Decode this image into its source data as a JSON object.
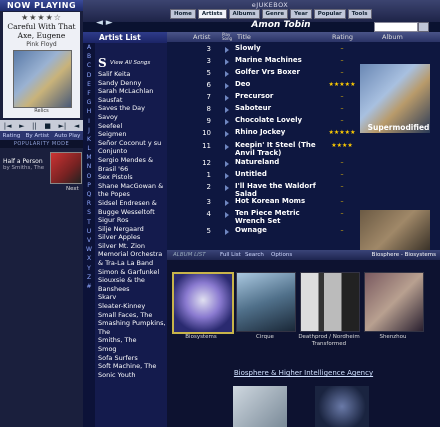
{
  "left": {
    "now_playing": "NOW PLAYING",
    "stars": "★★★★☆",
    "song": "Careful With That Axe, Eugene",
    "artist": "Pink Floyd",
    "album": "Relics",
    "controls": [
      "|◄",
      "►",
      "||",
      "■",
      "►|",
      "◄"
    ],
    "tabs": [
      "Rating",
      "By Artist",
      "Auto Play"
    ],
    "popularity_mode": "POPULARITY MODE",
    "next_song": "Half a Person",
    "next_artist": "by Smiths, The",
    "next_label": "Next"
  },
  "header": {
    "app_title": "eJUKEBOX",
    "nav": [
      "Home",
      "Artists",
      "Albums",
      "Genre",
      "Year",
      "Popular",
      "Tools"
    ],
    "active_nav": "Artists",
    "back": "◄",
    "forward": "►",
    "current_artist": "Amon Tobin"
  },
  "artist_list": {
    "title": "Artist List",
    "alphabet": [
      "A",
      "B",
      "C",
      "D",
      "E",
      "F",
      "G",
      "H",
      "I",
      "J",
      "K",
      "L",
      "M",
      "N",
      "O",
      "P",
      "Q",
      "R",
      "S",
      "T",
      "U",
      "V",
      "W",
      "X",
      "Y",
      "Z",
      "#"
    ],
    "letter": "S",
    "view_all": "View All Songs",
    "artists": [
      "Salif Keita",
      "Sandy Denny",
      "Sarah McLachlan",
      "Sausfat",
      "Saves the Day",
      "Savoy",
      "Seefeel",
      "Seigmen",
      "Señor Coconut y su Conjunto",
      "Sergio Mendes & Brasil '66",
      "Sex Pistols",
      "Shane MacGowan & the Popes",
      "Sidsel Endresen & Bugge Wesseltoft",
      "Sigur Ros",
      "Silje Nergaard",
      "Silver Apples",
      "Silver Mt. Zion Memorial Orchestra & Tra-La La Band",
      "Simon & Garfunkel",
      "Siouxsie & the Banshees",
      "Skarv",
      "Sleater-Kinney",
      "Small Faces, The",
      "Smashing Pumpkins, The",
      "Smiths, The",
      "Smog",
      "Sofa Surfers",
      "Soft Machine, The",
      "Sonic Youth"
    ]
  },
  "tracks": {
    "headers": {
      "artist": "Artist",
      "play": "Play Song",
      "title": "Title",
      "rating": "Rating",
      "album": "Album"
    },
    "rows": [
      {
        "num": "3",
        "title": "Slowly",
        "rating": "–"
      },
      {
        "num": "3",
        "title": "Marine Machines",
        "rating": "–"
      },
      {
        "num": "5",
        "title": "Golfer Vrs Boxer",
        "rating": "–"
      },
      {
        "num": "6",
        "title": "Deo",
        "rating": "★★★★★"
      },
      {
        "num": "7",
        "title": "Precursor",
        "rating": "–"
      },
      {
        "num": "8",
        "title": "Saboteur",
        "rating": "–"
      },
      {
        "num": "9",
        "title": "Chocolate Lovely",
        "rating": "–"
      },
      {
        "num": "10",
        "title": "Rhino Jockey",
        "rating": "★★★★★"
      },
      {
        "num": "11",
        "title": "Keepin' It Steel (The Anvil Track)",
        "rating": "★★★★"
      },
      {
        "num": "12",
        "title": "Natureland",
        "rating": "–"
      },
      {
        "num": "1",
        "title": "Untitled",
        "rating": "–"
      },
      {
        "num": "2",
        "title": "I'll Have the Waldorf Salad",
        "rating": "–"
      },
      {
        "num": "3",
        "title": "Hot Korean Moms",
        "rating": "–"
      },
      {
        "num": "4",
        "title": "Ten Piece Metric Wrench Set",
        "rating": "–"
      },
      {
        "num": "5",
        "title": "Ownage",
        "rating": "–"
      }
    ],
    "album_title": "Supermodified"
  },
  "bottom": {
    "tab_label": "ALBUM LIST",
    "tabs": [
      "Full List",
      "Search",
      "Options"
    ],
    "now_viewing": "Biosphere - Biosystems",
    "albums": [
      "Biosystems",
      "Cirque",
      "Deathprod / Nordheim Transformed",
      "Shenzhou"
    ],
    "label_link": "Biosphere & Higher Intelligence Agency"
  },
  "colors": {
    "accent": "#ffcc00",
    "panel": "#0e1740",
    "header": "#2a3366"
  }
}
